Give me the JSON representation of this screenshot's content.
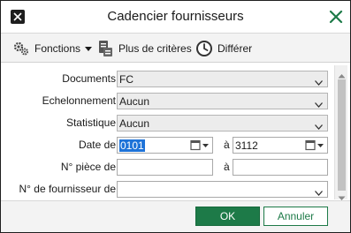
{
  "window": {
    "title": "Cadencier fournisseurs"
  },
  "toolbar": {
    "fonctions_label": "Fonctions",
    "criteres_label": "Plus de critères",
    "differer_label": "Différer"
  },
  "form": {
    "documents": {
      "label": "Documents",
      "value": "FC"
    },
    "echelonnement": {
      "label": "Echelonnement",
      "value": "Aucun"
    },
    "statistique": {
      "label": "Statistique",
      "value": "Aucun"
    },
    "date": {
      "label": "Date de",
      "from_value": "0101",
      "to_label": "à",
      "to_value": "3112"
    },
    "piece": {
      "label": "N° pièce de",
      "from_value": "",
      "to_label": "à",
      "to_value": ""
    },
    "fournisseur": {
      "label": "N° de fournisseur de",
      "value": ""
    }
  },
  "footer": {
    "ok_label": "OK",
    "cancel_label": "Annuler"
  },
  "colors": {
    "accent_green": "#1d7a48",
    "selection_blue": "#1e73d8",
    "toolbar_bg": "#f3f3f3"
  },
  "icons": {
    "close": "close-x-icon",
    "fonctions": "gears-icon",
    "criteres": "document-criteria-icon",
    "differer": "clock-icon",
    "calendar": "calendar-icon",
    "chevron": "chevron-down-icon"
  }
}
